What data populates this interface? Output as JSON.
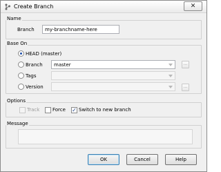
{
  "window": {
    "title": "Create Branch",
    "close_label": "✕"
  },
  "name_group": {
    "label": "Name",
    "branch_label": "Branch",
    "branch_value": "my-branchname-here"
  },
  "base_on": {
    "label": "Base On",
    "options": [
      {
        "label": "HEAD (master)",
        "checked": true
      },
      {
        "label": "Branch",
        "checked": false,
        "value": "master"
      },
      {
        "label": "Tags",
        "checked": false,
        "value": ""
      },
      {
        "label": "Version",
        "checked": false,
        "value": ""
      }
    ],
    "browse_label": "..."
  },
  "options_group": {
    "label": "Options",
    "track_label": "Track",
    "force_label": "Force",
    "switch_label": "Switch to new branch",
    "track_checked": false,
    "force_checked": false,
    "switch_checked": true,
    "check_mark": "✓"
  },
  "message_group": {
    "label": "Message"
  },
  "buttons": {
    "ok": "OK",
    "cancel": "Cancel",
    "help": "Help"
  }
}
